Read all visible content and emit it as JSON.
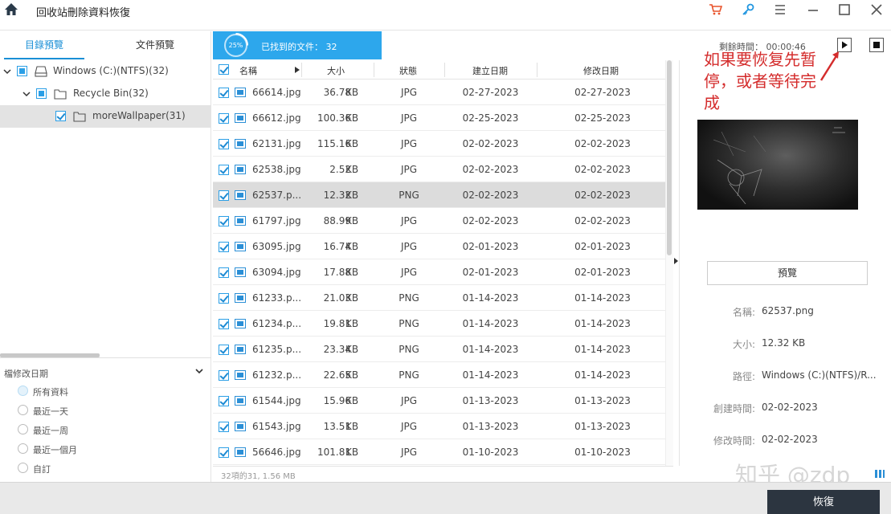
{
  "titlebar": {
    "title": "回收站刪除資料恢復"
  },
  "left": {
    "tabs": [
      {
        "label": "目錄預覽"
      },
      {
        "label": "文件預覽"
      }
    ],
    "tree": [
      {
        "label": "Windows (C:)(NTFS)(32)"
      },
      {
        "label": "Recycle Bin(32)"
      },
      {
        "label": "moreWallpaper(31)"
      }
    ],
    "filter": {
      "title": "檔修改日期",
      "options": [
        "所有資料",
        "最近一天",
        "最近一周",
        "最近一個月",
        "自訂"
      ]
    }
  },
  "scan": {
    "percent": "25%",
    "found_label": "已找到的文件：",
    "found_count": "32",
    "progress": 0.25
  },
  "timer": {
    "label": "剩餘時間：",
    "value": "00:00:46"
  },
  "annotation": {
    "text": "如果要恢复先暂停，或者等待完成",
    "color": "#d42c2c"
  },
  "table": {
    "headers": {
      "name": "名稱",
      "size": "大小",
      "status": "狀態",
      "created": "建立日期",
      "modified": "修改日期"
    },
    "rows": [
      {
        "name": "66614.jpg",
        "size": "36.78",
        "unit": "KB",
        "type": "JPG",
        "created": "02-27-2023",
        "modified": "02-27-2023"
      },
      {
        "name": "66612.jpg",
        "size": "100.36",
        "unit": "KB",
        "type": "JPG",
        "created": "02-25-2023",
        "modified": "02-25-2023"
      },
      {
        "name": "62131.jpg",
        "size": "115.16",
        "unit": "KB",
        "type": "JPG",
        "created": "02-02-2023",
        "modified": "02-02-2023"
      },
      {
        "name": "62538.jpg",
        "size": "2.52",
        "unit": "KB",
        "type": "JPG",
        "created": "02-02-2023",
        "modified": "02-02-2023"
      },
      {
        "name": "62537.p...",
        "size": "12.32",
        "unit": "KB",
        "type": "PNG",
        "created": "02-02-2023",
        "modified": "02-02-2023"
      },
      {
        "name": "61797.jpg",
        "size": "88.99",
        "unit": "KB",
        "type": "JPG",
        "created": "02-02-2023",
        "modified": "02-02-2023"
      },
      {
        "name": "63095.jpg",
        "size": "16.74",
        "unit": "KB",
        "type": "JPG",
        "created": "02-01-2023",
        "modified": "02-01-2023"
      },
      {
        "name": "63094.jpg",
        "size": "17.88",
        "unit": "KB",
        "type": "JPG",
        "created": "02-01-2023",
        "modified": "02-01-2023"
      },
      {
        "name": "61233.p...",
        "size": "21.03",
        "unit": "KB",
        "type": "PNG",
        "created": "01-14-2023",
        "modified": "01-14-2023"
      },
      {
        "name": "61234.p...",
        "size": "19.81",
        "unit": "KB",
        "type": "PNG",
        "created": "01-14-2023",
        "modified": "01-14-2023"
      },
      {
        "name": "61235.p...",
        "size": "23.34",
        "unit": "KB",
        "type": "PNG",
        "created": "01-14-2023",
        "modified": "01-14-2023"
      },
      {
        "name": "61232.p...",
        "size": "22.65",
        "unit": "KB",
        "type": "PNG",
        "created": "01-14-2023",
        "modified": "01-14-2023"
      },
      {
        "name": "61544.jpg",
        "size": "15.96",
        "unit": "KB",
        "type": "JPG",
        "created": "01-13-2023",
        "modified": "01-13-2023"
      },
      {
        "name": "61543.jpg",
        "size": "13.51",
        "unit": "KB",
        "type": "JPG",
        "created": "01-13-2023",
        "modified": "01-13-2023"
      },
      {
        "name": "56646.jpg",
        "size": "101.81",
        "unit": "KB",
        "type": "JPG",
        "created": "01-10-2023",
        "modified": "01-10-2023"
      }
    ],
    "status_text": "32項的31, 1.56 MB"
  },
  "preview": {
    "button_label": "預覽",
    "props": [
      {
        "label": "名稱:",
        "value": "62537.png"
      },
      {
        "label": "大小:",
        "value": "12.32  KB"
      },
      {
        "label": "路徑:",
        "value": "Windows (C:)(NTFS)/R..."
      },
      {
        "label": "創建時間:",
        "value": "02-02-2023"
      },
      {
        "label": "修改時間:",
        "value": "02-02-2023"
      }
    ]
  },
  "footer": {
    "recover_label": "恢復"
  },
  "watermark": {
    "text": "知乎 @zdp"
  },
  "colors": {
    "accent": "#2da7ec",
    "recover_bg": "#2c3540"
  }
}
